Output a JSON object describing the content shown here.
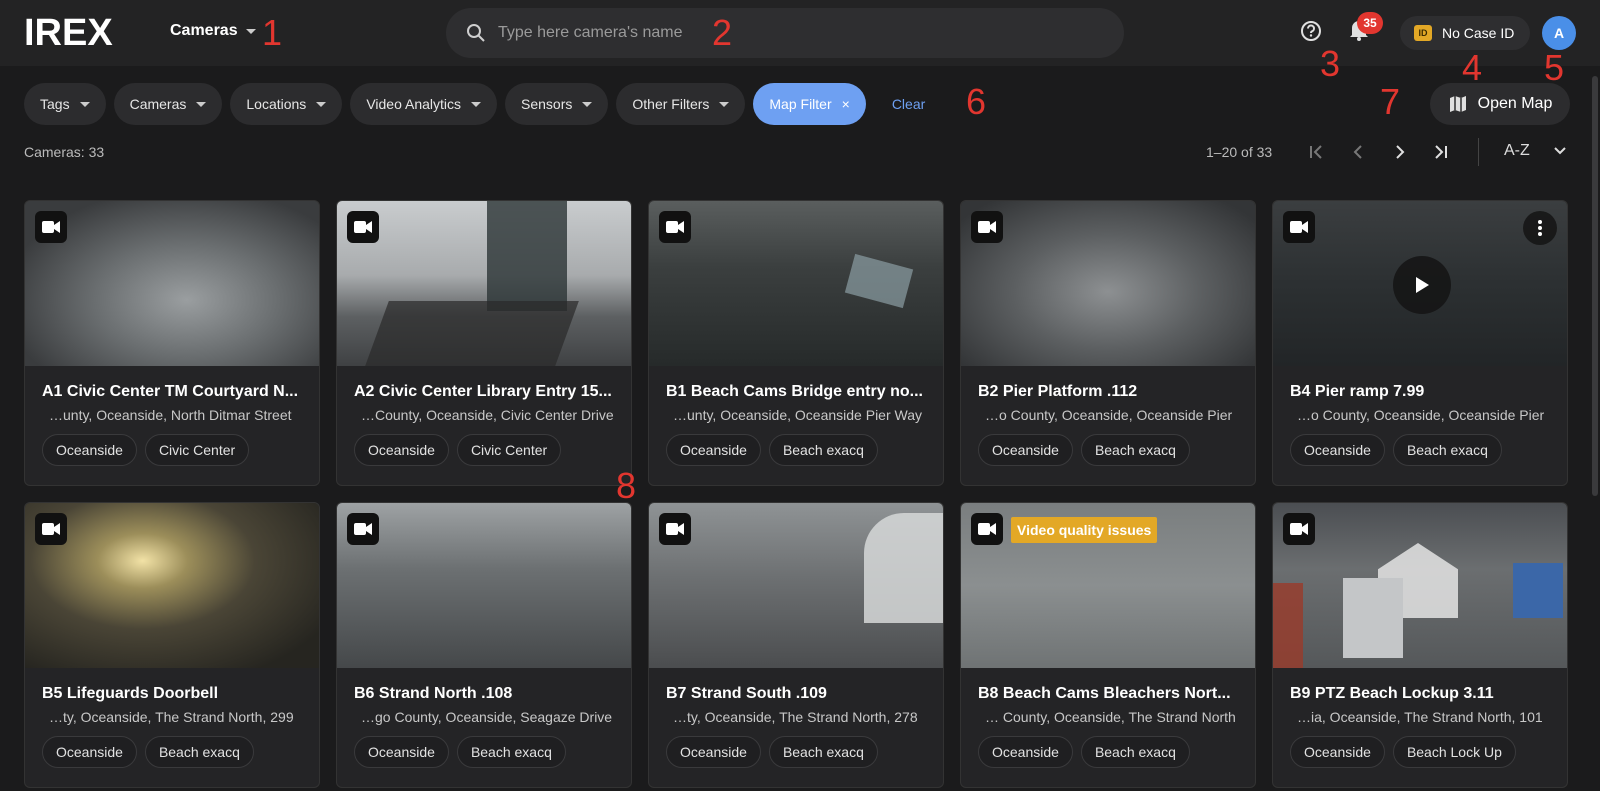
{
  "header": {
    "logo": "IREX",
    "nav_label": "Cameras",
    "search_placeholder": "Type here camera's name",
    "notification_count": "35",
    "case_icon": "ID",
    "case_label": "No Case ID",
    "avatar_initial": "A"
  },
  "annotations": [
    "1",
    "2",
    "3",
    "4",
    "5",
    "6",
    "7",
    "8"
  ],
  "filters": {
    "items": [
      "Tags",
      "Cameras",
      "Locations",
      "Video Analytics",
      "Sensors",
      "Other Filters"
    ],
    "active": "Map Filter",
    "active_close": "×",
    "clear": "Clear",
    "open_map": "Open Map"
  },
  "status": {
    "cameras_count": "Cameras: 33",
    "pager": "1–20 of 33",
    "sort": "A-Z"
  },
  "cameras": [
    {
      "title": "A1 Civic Center TM Courtyard N...",
      "location": "…unty, Oceanside, North Ditmar Street",
      "tags": [
        "Oceanside",
        "Civic Center"
      ]
    },
    {
      "title": "A2 Civic Center Library Entry 15...",
      "location": "…County, Oceanside, Civic Center Drive",
      "tags": [
        "Oceanside",
        "Civic Center"
      ]
    },
    {
      "title": "B1 Beach Cams Bridge entry no...",
      "location": "…unty, Oceanside, Oceanside Pier Way",
      "tags": [
        "Oceanside",
        "Beach exacq"
      ]
    },
    {
      "title": "B2 Pier Platform .112",
      "location": "…o County, Oceanside, Oceanside Pier",
      "tags": [
        "Oceanside",
        "Beach exacq"
      ]
    },
    {
      "title": "B4 Pier ramp 7.99",
      "location": "…o County, Oceanside, Oceanside Pier",
      "tags": [
        "Oceanside",
        "Beach exacq"
      ]
    },
    {
      "title": "B5 Lifeguards Doorbell",
      "location": "…ty, Oceanside, The Strand North, 299",
      "tags": [
        "Oceanside",
        "Beach exacq"
      ]
    },
    {
      "title": "B6 Strand North .108",
      "location": "…go County, Oceanside, Seagaze Drive",
      "tags": [
        "Oceanside",
        "Beach exacq"
      ]
    },
    {
      "title": "B7 Strand South .109",
      "location": "…ty, Oceanside, The Strand North, 278",
      "tags": [
        "Oceanside",
        "Beach exacq"
      ]
    },
    {
      "title": "B8 Beach Cams Bleachers Nort...",
      "location": "… County, Oceanside, The Strand North",
      "tags": [
        "Oceanside",
        "Beach exacq"
      ],
      "warning": "Video quality issues"
    },
    {
      "title": "B9 PTZ Beach Lockup 3.11",
      "location": "…ia, Oceanside, The Strand North, 101",
      "tags": [
        "Oceanside",
        "Beach Lock Up"
      ]
    }
  ],
  "icons": {
    "search": "search-icon",
    "help": "help-icon",
    "bell": "bell-icon",
    "map": "map-icon",
    "camera": "video-camera-icon",
    "play": "play-icon",
    "more": "more-vertical-icon"
  },
  "colors": {
    "accent": "#6ea0f2",
    "badge": "#e2362f",
    "warning": "#e3a826",
    "annotation": "#e2362f"
  }
}
